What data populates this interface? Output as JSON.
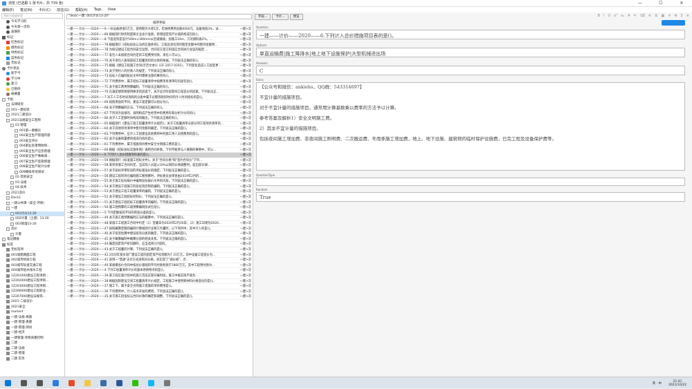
{
  "window": {
    "title": "浏览 (已选取 1 张卡片，共 739 张)",
    "controls": [
      "—",
      "☐",
      "✕"
    ]
  },
  "menu": [
    "编辑(E)",
    "笔记(N)",
    "卡片(C)",
    "前往(G)",
    "帮助(H)",
    "Tags",
    "View"
  ],
  "sidebar": {
    "search_placeholder": "筛选卡组或标签",
    "items": [
      {
        "label": "今天学习的",
        "indent": 1,
        "icon": "clock",
        "color": "#555"
      },
      {
        "label": "今天第一次的",
        "indent": 1,
        "icon": "clock",
        "color": "#555"
      },
      {
        "label": "逾期的",
        "indent": 1,
        "icon": "clock",
        "color": "#555"
      },
      {
        "label": "标记",
        "indent": 0,
        "icon": "flag",
        "color": "#555"
      },
      {
        "label": "红色标记",
        "indent": 1,
        "icon": "flag",
        "color": "#e53935"
      },
      {
        "label": "橙色标记",
        "indent": 1,
        "icon": "flag",
        "color": "#fb8c00"
      },
      {
        "label": "绿色标记",
        "indent": 1,
        "icon": "flag",
        "color": "#43a047"
      },
      {
        "label": "蓝色标记",
        "indent": 1,
        "icon": "flag",
        "color": "#1e88e5"
      },
      {
        "label": "无标记",
        "indent": 1,
        "icon": "flag",
        "color": "#999"
      },
      {
        "label": "卡片状态",
        "indent": 0,
        "icon": "circle",
        "color": "#777"
      },
      {
        "label": "新学卡",
        "indent": 1,
        "icon": "circle",
        "color": "#1e88e5"
      },
      {
        "label": "学习中",
        "indent": 1,
        "icon": "circle",
        "color": "#e53935"
      },
      {
        "label": "复习",
        "indent": 1,
        "icon": "circle",
        "color": "#43a047"
      },
      {
        "label": "已暂停",
        "indent": 1,
        "icon": "circle",
        "color": "#fbc02d"
      },
      {
        "label": "被搁置",
        "indent": 1,
        "icon": "circle",
        "color": "#8e6e53"
      },
      {
        "label": "卡组",
        "indent": 0,
        "icon": "deck",
        "color": "#888"
      },
      {
        "label": "法律研究",
        "indent": 1,
        "icon": "deck",
        "color": "#888"
      },
      {
        "label": "001—建纪思",
        "indent": 1,
        "icon": "deck",
        "color": "#888"
      },
      {
        "label": "2021二建造价",
        "indent": 1,
        "icon": "deck",
        "color": "#888"
      },
      {
        "label": "2021法规安全工程师",
        "indent": 1,
        "icon": "deck",
        "color": "#888"
      },
      {
        "label": "01-管理",
        "indent": 2,
        "icon": "deck",
        "color": "#888"
      },
      {
        "label": "001第一章概论",
        "indent": 3,
        "icon": "deck",
        "color": "#888"
      },
      {
        "label": "002安全生产管理内容",
        "indent": 3,
        "icon": "deck",
        "color": "#888"
      },
      {
        "label": "003安全评价",
        "indent": 3,
        "icon": "deck",
        "color": "#888"
      },
      {
        "label": "004职业危害预防和...",
        "indent": 3,
        "icon": "deck",
        "color": "#888"
      },
      {
        "label": "005安全生产应急管理",
        "indent": 3,
        "icon": "deck",
        "color": "#888"
      },
      {
        "label": "006安全生产事故调...",
        "indent": 3,
        "icon": "deck",
        "color": "#888"
      },
      {
        "label": "007安全生产监管管理",
        "indent": 3,
        "icon": "deck",
        "color": "#888"
      },
      {
        "label": "008安全生产统计分析",
        "indent": 3,
        "icon": "deck",
        "color": "#888"
      },
      {
        "label": "009模拟考场测试",
        "indent": 3,
        "icon": "deck",
        "color": "#888"
      },
      {
        "label": "02-其他安全",
        "indent": 2,
        "icon": "deck",
        "color": "#888"
      },
      {
        "label": "03-法规",
        "indent": 2,
        "icon": "deck",
        "color": "#888"
      },
      {
        "label": "04-技术",
        "indent": 2,
        "icon": "deck",
        "color": "#888"
      },
      {
        "label": "2021造价",
        "indent": 1,
        "icon": "deck",
        "color": "#888"
      },
      {
        "label": "Deck1",
        "indent": 1,
        "icon": "deck",
        "color": "#888"
      },
      {
        "label": "一建公共课（安全·环保）",
        "indent": 1,
        "icon": "deck",
        "color": "#888"
      },
      {
        "label": "一建",
        "indent": 1,
        "icon": "deck",
        "color": "#888"
      },
      {
        "label": "001计价13-20",
        "indent": 2,
        "icon": "deck",
        "color": "#888",
        "selected": true
      },
      {
        "label": "002计量（土建）13-20",
        "indent": 2,
        "icon": "deck",
        "color": "#888"
      },
      {
        "label": "003管理13-20",
        "indent": 2,
        "icon": "deck",
        "color": "#888"
      },
      {
        "label": "造价",
        "indent": 1,
        "icon": "deck",
        "color": "#888"
      },
      {
        "label": "计量",
        "indent": 2,
        "icon": "deck",
        "color": "#888"
      },
      {
        "label": "笔记模板",
        "indent": 0,
        "icon": "deck",
        "color": "#888"
      },
      {
        "label": "标签",
        "indent": 0,
        "icon": "tag",
        "color": "#888"
      },
      {
        "label": "无标签项",
        "indent": 1,
        "icon": "tag",
        "color": "#888"
      },
      {
        "label": "001城建路面工程",
        "indent": 1,
        "icon": "tag",
        "color": "#888"
      },
      {
        "label": "002城市桥梁工程",
        "indent": 1,
        "icon": "tag",
        "color": "#888"
      },
      {
        "label": "003城市轨道交通工程",
        "indent": 1,
        "icon": "tag",
        "color": "#888"
      },
      {
        "label": "004城市给水排水工程",
        "indent": 1,
        "icon": "tag",
        "color": "#888"
      },
      {
        "label": "1Z201000建设工程项目...",
        "indent": 1,
        "icon": "tag",
        "color": "#888"
      },
      {
        "label": "1Z202000建设工程项目...",
        "indent": 1,
        "icon": "tag",
        "color": "#888"
      },
      {
        "label": "1Z203000建设工程项目...",
        "indent": 1,
        "icon": "tag",
        "color": "#888"
      },
      {
        "label": "1Z206000建设工程职业...",
        "indent": 1,
        "icon": "tag",
        "color": "#888"
      },
      {
        "label": "1Z207000建设法规等...",
        "indent": 1,
        "icon": "tag",
        "color": "#888"
      },
      {
        "label": "2021-二级造价",
        "indent": 1,
        "icon": "tag",
        "color": "#888"
      },
      {
        "label": "2021安全",
        "indent": 1,
        "icon": "tag",
        "color": "#888"
      },
      {
        "label": "marked",
        "indent": 1,
        "icon": "tag",
        "color": "#888"
      },
      {
        "label": "一建-法规-真题",
        "indent": 1,
        "icon": "tag",
        "color": "#888"
      },
      {
        "label": "一建-管理-真题",
        "indent": 1,
        "icon": "tag",
        "color": "#888"
      },
      {
        "label": "一建-管理-测试",
        "indent": 1,
        "icon": "tag",
        "color": "#888"
      },
      {
        "label": "一建-经济",
        "indent": 1,
        "icon": "tag",
        "color": "#888"
      },
      {
        "label": "一建管理-项目质量控制",
        "indent": 1,
        "icon": "tag",
        "color": "#888"
      },
      {
        "label": "二建",
        "indent": 1,
        "icon": "tag",
        "color": "#888"
      },
      {
        "label": "二建-法规",
        "indent": 1,
        "icon": "tag",
        "color": "#888"
      },
      {
        "label": "二建-管理",
        "indent": 1,
        "icon": "tag",
        "color": "#888"
      },
      {
        "label": "二建-实务",
        "indent": 1,
        "icon": "tag",
        "color": "#888"
      }
    ]
  },
  "browser": {
    "search_value": "\"deck:一建::001计价13-20\"",
    "column_header": "排序字段",
    "column2": "",
    "rows": [
      {
        "text": "一建——计价——2020——9.一份设备原值5万元，使用期为大修1次，年维修费用总额4000元，设备残值3%，试…",
        "deck": "一建>次"
      },
      {
        "text": "一建——计价——2020——80.根据现行财务制度和企业会计准则，新增固定资产价值的构成包括()。",
        "deck": "一建>次"
      },
      {
        "text": "一建——计价——2020——8.下面选项是设计500m×300mm以后城镇质，加施工24m，只对钢料质2%，…",
        "deck": "一建>次"
      },
      {
        "text": "一建——计价——2020——79.根据我们《招标投标公法的实施条例》，工程总承包项目暂定金额中的暂列金额明…",
        "deck": "一建>次"
      },
      {
        "text": "一建——计价——2020——78.为保证建设工程合同安全运营，合同双方签订的适应合同执行会议的规定…",
        "deck": "一建>次"
      },
      {
        "text": "一建——计价——2020——77.发包人未按照合同约定的工程费预付款，承包人可以()。",
        "deck": "一建>次"
      },
      {
        "text": "一建——计价——2020——76.关于承包人质保部成工程量资料的价款的依据，下列说法正确的有()。",
        "deck": "一建>次"
      },
      {
        "text": "一建——计价——2020——75.根据《建设工程施工合同(示范文本)》(GF-2017-0201)，下列变化造成入工程变更…",
        "deck": "一建>次"
      },
      {
        "text": "一建——计价——2020——74.关于预付人的付款人的规定，下列说法正确的有()。",
        "deck": "一建>次"
      },
      {
        "text": "一建——计价——2020——73.投标人在编制投标文件时需要注意的事项有()。",
        "deck": "一建>次"
      },
      {
        "text": "一建——计价——2020——72.下列费用中，属于招标工程量清单中规费项目清单的内容包括()。",
        "deck": "一建>次"
      },
      {
        "text": "一建——计价——2020——71.关于施工费用预算编制，下列说法正确的有()。",
        "deck": "一建>次"
      },
      {
        "text": "一建——计价——2020——70.在满足建筑物使用要求的前提下，关于设计阶段影响工程造价的因素，下列说法正…",
        "deck": "一建>次"
      },
      {
        "text": "一建——计价——2020——7.对工人工作时间消耗的分类中属于必需消耗的时间的计入时间指标的是()。",
        "deck": "一建>次"
      },
      {
        "text": "一建——计价——2020——69.按照用途的不同，建设工程定额可以划分为()。",
        "deck": "一建>次"
      },
      {
        "text": "一建——计价——2020——68.关于预算编制方法，下列说法正确的有()。",
        "deck": "一建>次"
      },
      {
        "text": "一建——计价——2020——67.下列对外直接的，说明构成产生经营中的费用有和分析计价的有()。",
        "deck": "一建>次"
      },
      {
        "text": "一建——计价——2020——66.关于人工定额时间构成的概念，下列说法正确的有()。",
        "deck": "一建>次"
      },
      {
        "text": "一建——计价——2020——65.根据现行《建设工程工程量清单计价规范》，关于工程量清单分部分项工程项目清单的…",
        "deck": "一建>次"
      },
      {
        "text": "一建——计价——2020——64.关于其他项目清单中暂列金额的确定，下列说法正确的是()。",
        "deck": "一建>次"
      },
      {
        "text": "一建——计价——2020——63.下列费用中，应计入工程建设其他费用中的施工用人员租费用的是()。",
        "deck": "一建>次"
      },
      {
        "text": "一建——计价——2020——62.关于设备购置费的组成包括的是()。",
        "deck": "一建>次"
      },
      {
        "text": "一建——计价——2020——61.下列费用中，属于措施项目费中安全文明施工费的是()。",
        "deck": "一建>次"
      },
      {
        "text": "一建——计价——2020——60.根据《招标投标实施条例》通用合同条款，下列不能参与人要期的事情中，可以…",
        "deck": "一建>次"
      },
      {
        "text": "一建——计价——2020——6.下列计入总价措施项目表的是()。",
        "deck": "一建>次",
        "selected": true
      },
      {
        "text": "一建——计价——2020——59.根据现行《标准施工招标文件》，关于\"合同价格\"和\"签约合同价\"下列…",
        "deck": "一建>次"
      },
      {
        "text": "一建——计价——2020——58.某项目施工合同约定，当实际人员超±10%以限的价格调整时，超出部分调…",
        "deck": "一建>次"
      },
      {
        "text": "一建——计价——2020——57.关于投标评审阶段的评标基准价的确定，下列说法正确的是()。",
        "deck": "一建>次"
      },
      {
        "text": "一建——计价——2020——56.建设工程项目在编制施工图预算时，评标委员会审查由2019年2月的…",
        "deck": "一建>次"
      },
      {
        "text": "一建——计价——2020——55.关于施工投标报价中编制投标报价文件的内容，下列说法正确的是()。",
        "deck": "一建>次"
      },
      {
        "text": "一建——计价——2020——54.关于建设工程施工阶段投资控制的编制，下列说法正确的是()。",
        "deck": "一建>次"
      },
      {
        "text": "一建——计价——2020——53.关于建设工程工程量清单的编制，下列说法正确的是()。",
        "deck": "一建>次"
      },
      {
        "text": "一建——计价——2020——52.关于建设工程招标控制价，下列说法正确的是()。",
        "deck": "一建>次"
      },
      {
        "text": "一建——计价——2020——51.关于建设工程招标工程量清单的编制，下列说法正确的是()。",
        "deck": "一建>次"
      },
      {
        "text": "一建——计价——2020——50.施工图预算的三级预算编制形式包括()。",
        "deck": "一建>次"
      },
      {
        "text": "一建——计价——2020——5.下列定额按其不同的用途分类的是()。",
        "deck": "一建>次"
      },
      {
        "text": "一建——计价——2020——49.关于施工图预算编制方法的概算中，下列说法正确的是()。",
        "deck": "一建>次"
      },
      {
        "text": "一建——计价——2020——48.某施工工程施工合同中约定（1）签署日为2020年2月20日；（2）施工日期为2020…",
        "deck": "一建>次"
      },
      {
        "text": "一建——计价——2020——47.按照概算定额的编制计算规则计主要工作量时，以下项目中，其中计入的是()。",
        "deck": "一建>次"
      },
      {
        "text": "一建——计价——2020——46.关于投资估算中建设投资分类的确定，下列说法正确的是()。",
        "deck": "一建>次"
      },
      {
        "text": "一建——计价——2020——45.关于概算编制中概算分部的相关关系，下列说法正确的是()。",
        "deck": "一建>次"
      },
      {
        "text": "一建——计价——2020——44.确定固定资产折旧额时，应当选择()计提的。",
        "deck": "一建>次"
      },
      {
        "text": "一建——计价——2020——43.关于工程量的计算，下列说法正确的是()。",
        "deck": "一建>次"
      },
      {
        "text": "一建——计价——2020——42.2020年某水泥厂建设工程的固定资产投资额为7.31亿元，其中设备工程造价为…",
        "deck": "一建>次"
      },
      {
        "text": "一建——计价——2020——41.采用一\"普通\"支付方式采购对价格，如实现了\"调价格\"，合…",
        "deck": "一建>次"
      },
      {
        "text": "一建——计价——2020——40.某规模总价合同中按总价基础的平均付款利款于1800万元，其中工程预付款为…",
        "deck": "一建>次"
      },
      {
        "text": "一建——计价——2020——4.下列工程量清单计价的基本原则特点的是()。",
        "deck": "一建>次"
      },
      {
        "text": "一建——计价——2020——39.某工程实施计划中的施工完成实际开展时段，施工中报实际产值为…",
        "deck": "一建>次"
      },
      {
        "text": "一建——计价——2020——38.根据国际建设交易工程量清单计价规定，工程施工中使用和材料价格变化的是()。",
        "deck": "一建>次"
      },
      {
        "text": "一建——计价——2020——37.施工下，属于安全文明施工措施的项目费用是()。",
        "deck": "一建>次"
      },
      {
        "text": "一建——计价——2020——36.下列费用中，计入技术开发的费用，下列说法正确的是()。",
        "deck": "一建>次"
      },
      {
        "text": "一建——计价——2020——35.关于施工招投标与合同价款的确定和调整，下列说法正确的是()。",
        "deck": "一建>次"
      }
    ]
  },
  "editor": {
    "toolbar": [
      "字段...",
      "卡片...",
      "预览"
    ],
    "format_icons": [
      "B",
      "I",
      "U",
      "x²",
      "x₂",
      "A",
      "✎",
      "⌫",
      "≡",
      "☰",
      "▦",
      "✳",
      "⊕",
      "Σ",
      "≡"
    ],
    "fields": [
      {
        "label": "Question",
        "value": "一建——计价——2020——6.下列计入总价措施项目表的是()。"
      },
      {
        "label": "Options",
        "value": "单直运输费|施工降排水|地上地下设施保护|大型机械进出场"
      },
      {
        "label": "Answers",
        "value": "C"
      },
      {
        "label": "Extra",
        "paragraphs": [
          "【公众号和微信：ankiehs，QQ群：543314697】",
          "不宜计量的措施项目。",
          "对于不宜计量的措施项目，通常用计算基数乘以费率的方法予以计算。",
          "参考答案及解析1）安全文明施工费。",
          "2）其余不宜计量的措施项目。",
          "包括夜间施工增加费、非夜间施工照明费、二次搬运费、冬雨季施工增加费，地上、地下设施、建筑物的临时保护设施费，已完工程及设备保护费等。"
        ]
      },
      {
        "label": "QuestionType",
        "value": ""
      },
      {
        "label": "Random",
        "value": "True"
      }
    ]
  },
  "taskbar": {
    "apps": [
      "windows-icon",
      "search-icon",
      "task-view-icon",
      "edge-icon",
      "chrome-icon",
      "file-explorer-icon",
      "anki-icon",
      "word-icon",
      "wechat-icon",
      "qq-icon",
      "settings-icon"
    ],
    "tray_text": "英 · 中",
    "time": "21:41",
    "date": "2021/10/22"
  }
}
